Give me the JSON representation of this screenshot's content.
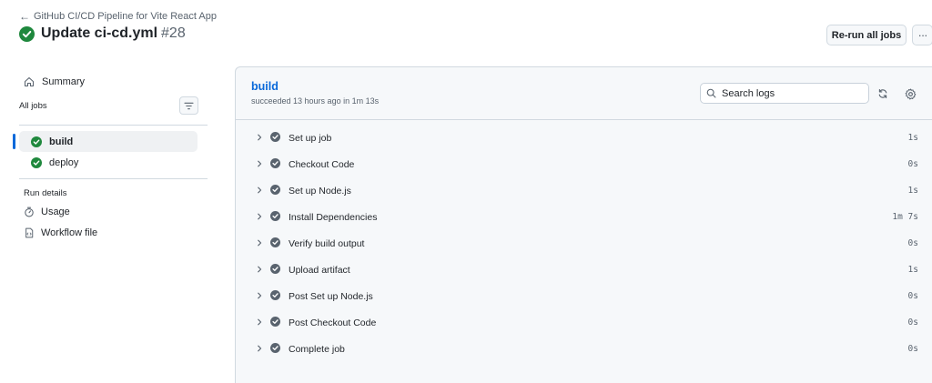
{
  "header": {
    "back_link": "GitHub CI/CD Pipeline for Vite React App",
    "title": "Update ci-cd.yml",
    "run_number": "#28",
    "rerun_label": "Re-run all jobs",
    "more_label": "···",
    "status_color": "#1f883d"
  },
  "sidebar": {
    "summary_label": "Summary",
    "all_jobs_label": "All jobs",
    "jobs": [
      {
        "label": "build",
        "active": true
      },
      {
        "label": "deploy",
        "active": false
      }
    ],
    "run_details_label": "Run details",
    "details": [
      {
        "label": "Usage",
        "icon": "stopwatch-icon"
      },
      {
        "label": "Workflow file",
        "icon": "file-icon"
      }
    ]
  },
  "job": {
    "name": "build",
    "meta": "succeeded 13 hours ago in 1m 13s",
    "search_placeholder": "Search logs",
    "steps": [
      {
        "label": "Set up job",
        "duration": "1s"
      },
      {
        "label": "Checkout Code",
        "duration": "0s"
      },
      {
        "label": "Set up Node.js",
        "duration": "1s"
      },
      {
        "label": "Install Dependencies",
        "duration": "1m 7s"
      },
      {
        "label": "Verify build output",
        "duration": "0s"
      },
      {
        "label": "Upload artifact",
        "duration": "1s"
      },
      {
        "label": "Post Set up Node.js",
        "duration": "0s"
      },
      {
        "label": "Post Checkout Code",
        "duration": "0s"
      },
      {
        "label": "Complete job",
        "duration": "0s"
      }
    ]
  }
}
